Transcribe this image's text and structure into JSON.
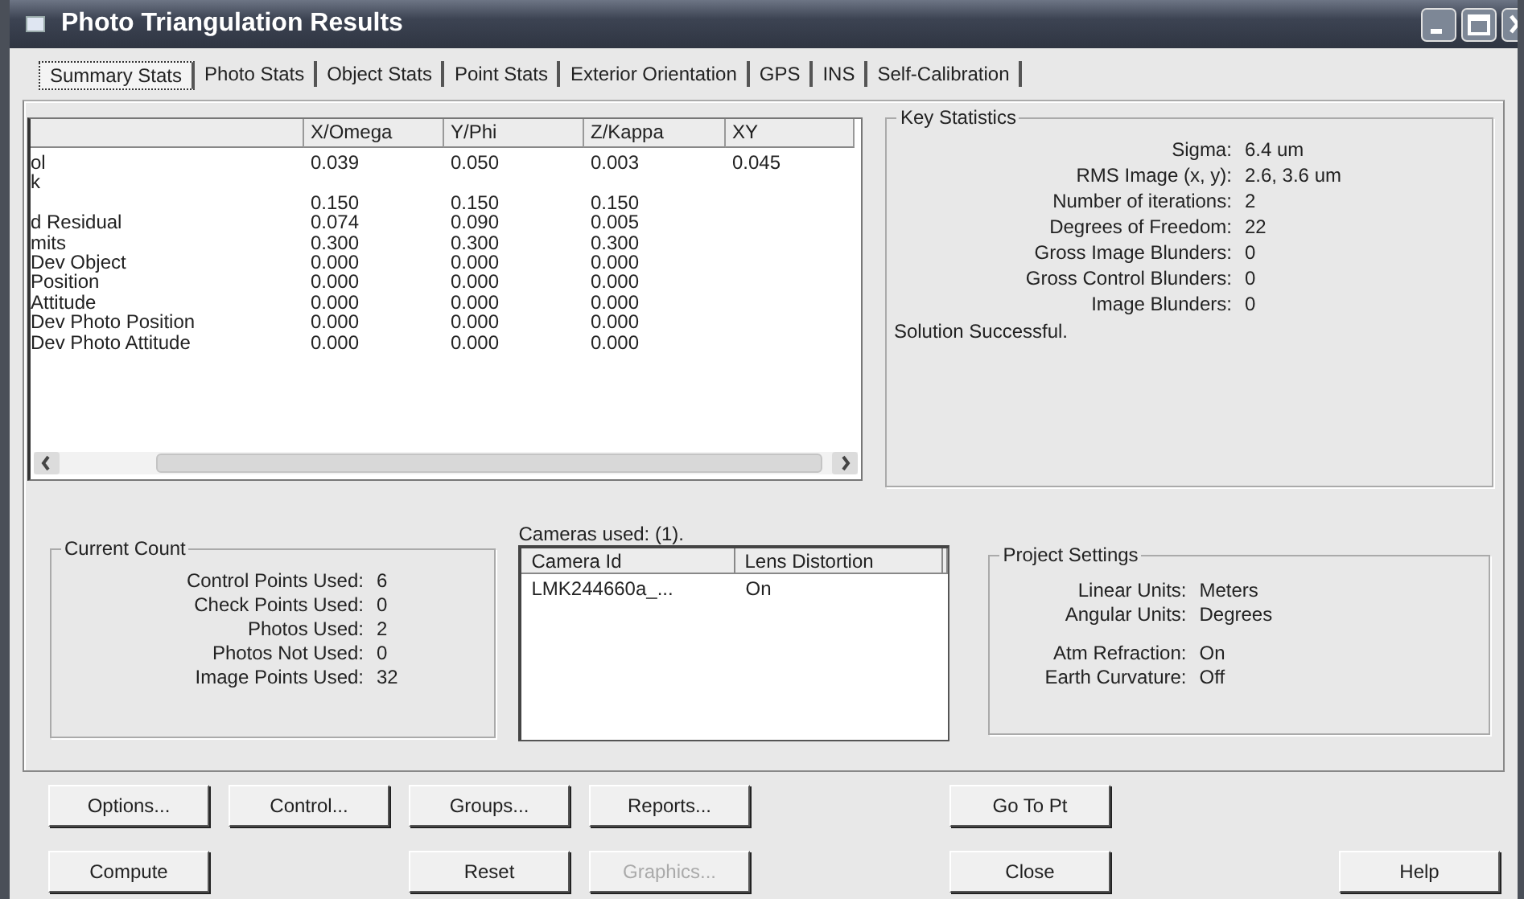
{
  "window": {
    "title": "Photo Triangulation Results"
  },
  "tabs": [
    {
      "label": "Summary Stats",
      "selected": true
    },
    {
      "label": "Photo Stats",
      "selected": false
    },
    {
      "label": "Object Stats",
      "selected": false
    },
    {
      "label": "Point Stats",
      "selected": false
    },
    {
      "label": "Exterior Orientation",
      "selected": false
    },
    {
      "label": "GPS",
      "selected": false
    },
    {
      "label": "INS",
      "selected": false
    },
    {
      "label": "Self-Calibration",
      "selected": false
    }
  ],
  "stats_table": {
    "columns": [
      "X/Omega",
      "Y/Phi",
      "Z/Kappa",
      "XY"
    ],
    "rows": [
      {
        "label": "ol",
        "values": [
          "0.039",
          "0.050",
          "0.003",
          "0.045"
        ]
      },
      {
        "label": "k",
        "values": []
      },
      {
        "values": [
          "0.150",
          "0.150",
          "0.150"
        ]
      },
      {
        "label": "d Residual",
        "values": [
          "0.074",
          "0.090",
          "0.005"
        ]
      },
      {
        "label": "mits",
        "values": [
          "0.300",
          "0.300",
          "0.300"
        ]
      },
      {
        "label": "Dev Object",
        "values": [
          "0.000",
          "0.000",
          "0.000"
        ]
      },
      {
        "label": "Position",
        "values": [
          "0.000",
          "0.000",
          "0.000"
        ]
      },
      {
        "label": "Attitude",
        "values": [
          "0.000",
          "0.000",
          "0.000"
        ]
      },
      {
        "label": "Dev Photo Position",
        "values": [
          "0.000",
          "0.000",
          "0.000"
        ]
      },
      {
        "label": "Dev Photo Attitude",
        "values": [
          "0.000",
          "0.000",
          "0.000"
        ]
      }
    ]
  },
  "key_statistics": {
    "title": "Key Statistics",
    "items": [
      {
        "label": "Sigma:",
        "value": "6.4  um"
      },
      {
        "label": "RMS Image (x, y):",
        "value": "2.6,  3.6  um"
      },
      {
        "label": "Number of iterations:",
        "value": "2"
      },
      {
        "label": "Degrees of Freedom:",
        "value": "22"
      },
      {
        "label": "Gross Image Blunders:",
        "value": "0"
      },
      {
        "label": "Gross Control Blunders:",
        "value": "0"
      },
      {
        "label": "Image Blunders:",
        "value": "0"
      }
    ],
    "message": "Solution Successful."
  },
  "current_count": {
    "title": "Current Count",
    "items": [
      {
        "label": "Control Points Used:",
        "value": "6"
      },
      {
        "label": "Check Points Used:",
        "value": "0"
      },
      {
        "label": "Photos Used:",
        "value": "2"
      },
      {
        "label": "Photos Not Used:",
        "value": "0"
      },
      {
        "label": "Image Points Used:",
        "value": "32"
      }
    ]
  },
  "cameras": {
    "label": "Cameras used: (1).",
    "columns": [
      "Camera Id",
      "Lens Distortion"
    ],
    "rows": [
      [
        "LMK244660a_...",
        "On"
      ]
    ]
  },
  "project_settings": {
    "title": "Project Settings",
    "groups": [
      [
        {
          "label": "Linear Units:",
          "value": "Meters"
        },
        {
          "label": "Angular Units:",
          "value": "Degrees"
        }
      ],
      [
        {
          "label": "Atm Refraction:",
          "value": "On"
        },
        {
          "label": "Earth Curvature:",
          "value": "Off"
        }
      ]
    ]
  },
  "button_rows": [
    [
      {
        "label": "Options...",
        "disabled": false
      },
      {
        "label": "Control...",
        "disabled": false
      },
      {
        "label": "Groups...",
        "disabled": false
      },
      {
        "label": "Reports...",
        "disabled": false
      },
      {
        "label": "Go To Pt",
        "disabled": false
      }
    ],
    [
      {
        "label": "Compute",
        "disabled": false
      },
      {
        "label": "Reset",
        "disabled": false
      },
      {
        "label": "Graphics...",
        "disabled": true
      },
      {
        "label": "Close",
        "disabled": false
      },
      {
        "label": "Help",
        "disabled": false
      }
    ]
  ]
}
